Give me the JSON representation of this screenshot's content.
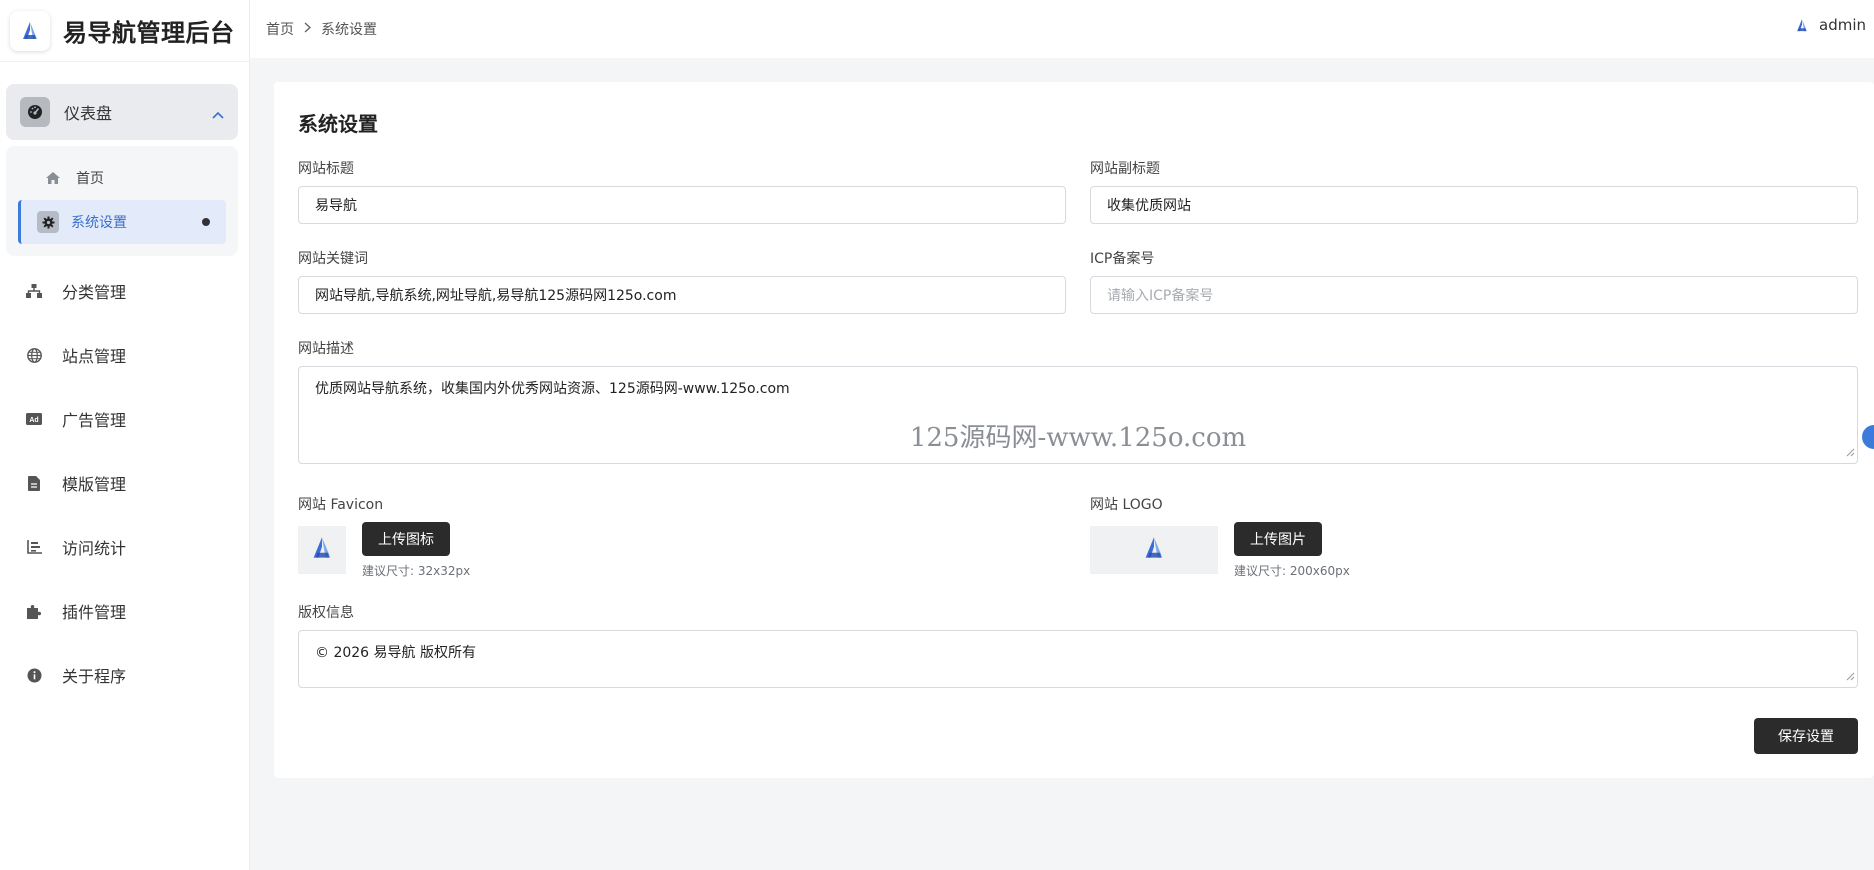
{
  "brand": {
    "title": "易导航管理后台",
    "logo_icon": "a-logo-icon"
  },
  "sidebar": {
    "group": {
      "label": "仪表盘",
      "icon": "dashboard-icon",
      "expanded": true
    },
    "sub_items": [
      {
        "label": "首页",
        "icon": "home-icon"
      },
      {
        "label": "系统设置",
        "icon": "gear-icon",
        "active": true
      }
    ],
    "items": [
      {
        "label": "分类管理",
        "icon": "sitemap-icon"
      },
      {
        "label": "站点管理",
        "icon": "globe-icon"
      },
      {
        "label": "广告管理",
        "icon": "ad-icon"
      },
      {
        "label": "模版管理",
        "icon": "file-icon"
      },
      {
        "label": "访问统计",
        "icon": "chart-icon"
      },
      {
        "label": "插件管理",
        "icon": "puzzle-icon"
      },
      {
        "label": "关于程序",
        "icon": "info-icon"
      }
    ]
  },
  "breadcrumb": {
    "home": "首页",
    "current": "系统设置"
  },
  "user": {
    "name": "admin"
  },
  "form": {
    "title": "系统设置",
    "site_title": {
      "label": "网站标题",
      "value": "易导航"
    },
    "site_subtitle": {
      "label": "网站副标题",
      "value": "收集优质网站"
    },
    "keywords": {
      "label": "网站关键词",
      "value": "网站导航,导航系统,网址导航,易导航125源码网125o.com"
    },
    "icp": {
      "label": "ICP备案号",
      "value": "",
      "placeholder": "请输入ICP备案号"
    },
    "description": {
      "label": "网站描述",
      "value": "优质网站导航系统，收集国内外优秀网站资源、125源码网-www.125o.com"
    },
    "watermark": "125源码网-www.125o.com",
    "favicon": {
      "label": "网站 Favicon",
      "button": "上传图标",
      "hint": "建议尺寸: 32x32px"
    },
    "logo": {
      "label": "网站 LOGO",
      "button": "上传图片",
      "hint": "建议尺寸: 200x60px"
    },
    "copyright": {
      "label": "版权信息",
      "value": "© 2026 易导航 版权所有"
    },
    "save_button": "保存设置"
  },
  "colors": {
    "accent": "#3a7bdc",
    "dark_button": "#2b2b2b",
    "page_bg": "#f4f5f7"
  }
}
